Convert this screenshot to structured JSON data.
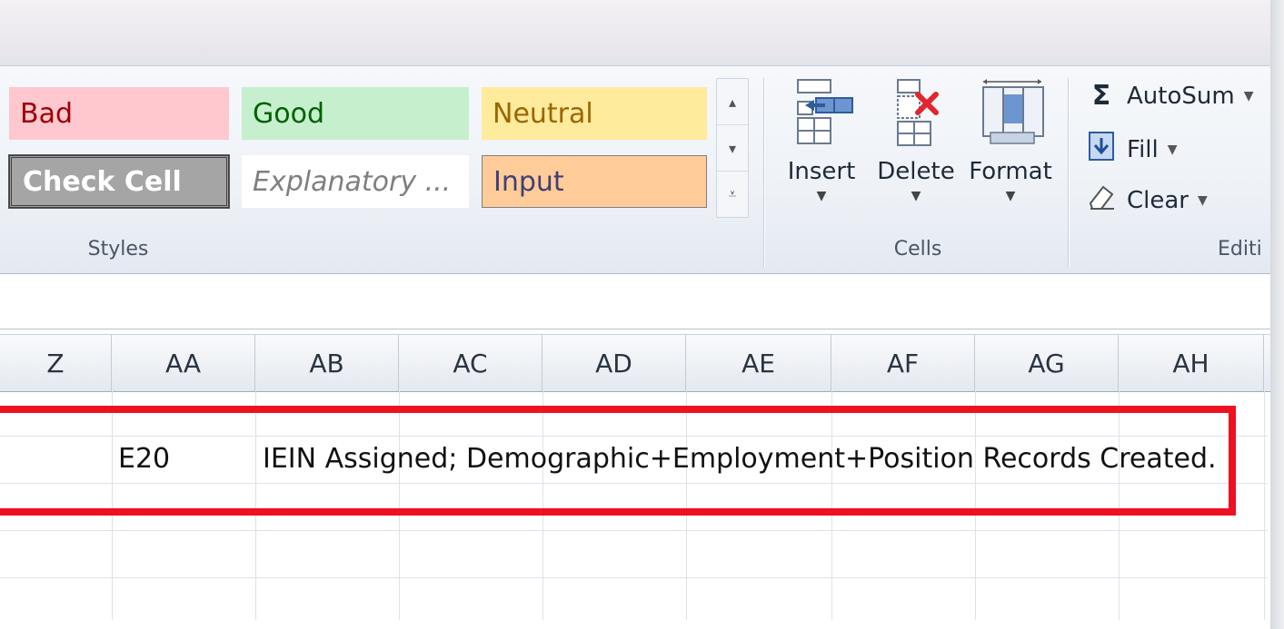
{
  "ribbon": {
    "styles": {
      "items": [
        {
          "label": "Bad",
          "bg": "#ffc7ce",
          "fg": "#9c0006"
        },
        {
          "label": "Good",
          "bg": "#c6efce",
          "fg": "#006100"
        },
        {
          "label": "Neutral",
          "bg": "#ffeb9c",
          "fg": "#9c6500"
        },
        {
          "label": "Check Cell",
          "bg": "#a5a5a5",
          "fg": "#ffffff"
        },
        {
          "label": "Explanatory ...",
          "bg": "#ffffff",
          "fg": "#7f7f7f"
        },
        {
          "label": "Input",
          "bg": "#ffcc99",
          "fg": "#3f3f76"
        }
      ],
      "group_label": "Styles"
    },
    "cells": {
      "insert_label": "Insert",
      "delete_label": "Delete",
      "format_label": "Format",
      "group_label": "Cells"
    },
    "editing": {
      "autosum_label": "AutoSum",
      "fill_label": "Fill",
      "clear_label": "Clear",
      "group_label": "Editi",
      "sigma": "Σ"
    }
  },
  "grid": {
    "columns": [
      "Z",
      "AA",
      "AB",
      "AC",
      "AD",
      "AE",
      "AF",
      "AG",
      "AH"
    ],
    "row_cells": {
      "aa": "E20",
      "ab": "IEIN Assigned; Demographic+Employment+Position Records Created."
    },
    "highlight_color": "#ee1122"
  }
}
